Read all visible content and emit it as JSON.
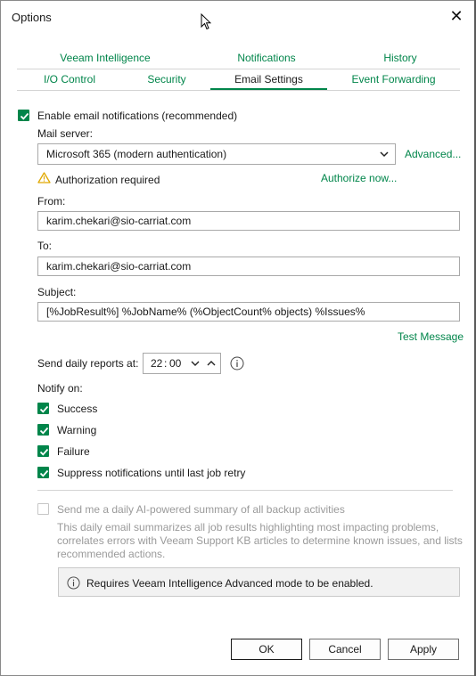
{
  "window": {
    "title": "Options"
  },
  "tabs_row1": [
    {
      "label": "Veeam Intelligence"
    },
    {
      "label": "Notifications"
    },
    {
      "label": "History"
    }
  ],
  "tabs_row2": [
    {
      "label": "I/O Control"
    },
    {
      "label": "Security"
    },
    {
      "label": "Email Settings",
      "active": true
    },
    {
      "label": "Event Forwarding"
    }
  ],
  "email": {
    "enable_label": "Enable email notifications (recommended)",
    "enable_checked": true,
    "mail_server_label": "Mail server:",
    "mail_server_value": "Microsoft 365 (modern authentication)",
    "advanced_link": "Advanced...",
    "auth_required": "Authorization required",
    "authorize_link": "Authorize now...",
    "from_label": "From:",
    "from_value": "karim.chekari@sio-carriat.com",
    "to_label": "To:",
    "to_value": "karim.chekari@sio-carriat.com",
    "subject_label": "Subject:",
    "subject_value": "[%JobResult%] %JobName% (%ObjectCount% objects) %Issues%",
    "test_link": "Test Message",
    "daily_label": "Send daily reports at:",
    "daily_hour": "22",
    "daily_minute": "00",
    "notify_label": "Notify on:",
    "notify": [
      {
        "label": "Success",
        "checked": true
      },
      {
        "label": "Warning",
        "checked": true
      },
      {
        "label": "Failure",
        "checked": true
      },
      {
        "label": "Suppress notifications until last job retry",
        "checked": true
      }
    ],
    "ai_summary_label": "Send me a daily AI-powered summary of all backup activities",
    "ai_summary_checked": false,
    "ai_summary_desc": [
      "This daily email summarizes all job results highlighting most impacting problems,",
      "correlates errors with Veeam Support KB articles to determine known issues, and lists",
      "recommended actions."
    ],
    "info_text": "Requires Veeam Intelligence Advanced mode to be enabled."
  },
  "buttons": {
    "ok": "OK",
    "cancel": "Cancel",
    "apply": "Apply"
  },
  "colors": {
    "accent": "#00854a",
    "warning": "#e0a800",
    "border": "#a9a9a9"
  }
}
